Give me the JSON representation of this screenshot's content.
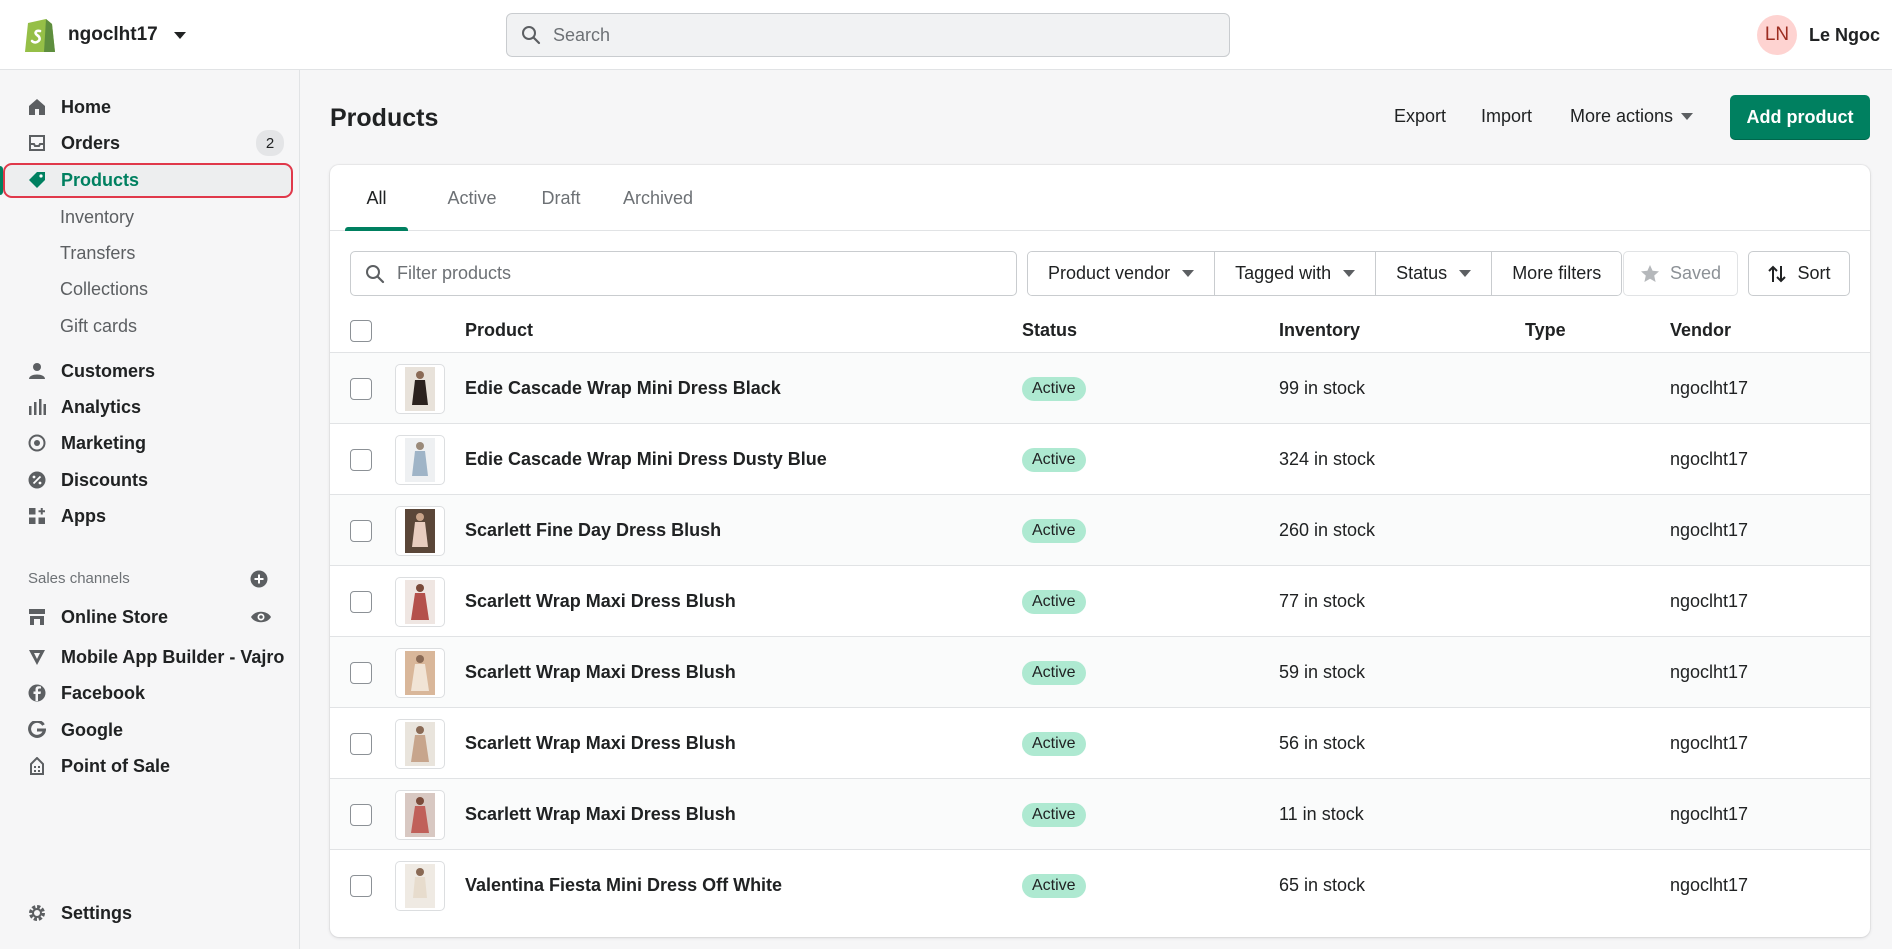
{
  "topbar": {
    "store_name": "ngoclht17",
    "search_placeholder": "Search",
    "user_initials": "LN",
    "user_name": "Le Ngoc"
  },
  "sidebar": {
    "items": [
      {
        "label": "Home",
        "icon": "home-icon"
      },
      {
        "label": "Orders",
        "icon": "inbox-icon",
        "badge": "2"
      },
      {
        "label": "Products",
        "icon": "tag-icon",
        "active": true
      },
      {
        "label": "Customers",
        "icon": "person-icon"
      },
      {
        "label": "Analytics",
        "icon": "bar-chart-icon"
      },
      {
        "label": "Marketing",
        "icon": "target-icon"
      },
      {
        "label": "Discounts",
        "icon": "discount-icon"
      },
      {
        "label": "Apps",
        "icon": "apps-icon"
      }
    ],
    "sub_items": [
      "Inventory",
      "Transfers",
      "Collections",
      "Gift cards"
    ],
    "sales_channels_label": "Sales channels",
    "channels": [
      {
        "label": "Online Store",
        "icon": "store-icon"
      },
      {
        "label": "Mobile App Builder - Vajro",
        "icon": "vajro-icon"
      },
      {
        "label": "Facebook",
        "icon": "facebook-icon"
      },
      {
        "label": "Google",
        "icon": "google-icon"
      },
      {
        "label": "Point of Sale",
        "icon": "pos-icon"
      }
    ],
    "settings_label": "Settings"
  },
  "page": {
    "title": "Products",
    "export_label": "Export",
    "import_label": "Import",
    "more_actions_label": "More actions",
    "add_product_label": "Add product"
  },
  "tabs": [
    "All",
    "Active",
    "Draft",
    "Archived"
  ],
  "filters": {
    "placeholder": "Filter products",
    "product_vendor": "Product vendor",
    "tagged_with": "Tagged with",
    "status": "Status",
    "more_filters": "More filters",
    "saved": "Saved",
    "sort": "Sort"
  },
  "table": {
    "headers": {
      "product": "Product",
      "status": "Status",
      "inventory": "Inventory",
      "type": "Type",
      "vendor": "Vendor"
    },
    "rows": [
      {
        "product": "Edie Cascade Wrap Mini Dress Black",
        "status": "Active",
        "inventory": "99 in stock",
        "type": "",
        "vendor": "ngoclht17"
      },
      {
        "product": "Edie Cascade Wrap Mini Dress Dusty Blue",
        "status": "Active",
        "inventory": "324 in stock",
        "type": "",
        "vendor": "ngoclht17"
      },
      {
        "product": "Scarlett Fine Day Dress Blush",
        "status": "Active",
        "inventory": "260 in stock",
        "type": "",
        "vendor": "ngoclht17"
      },
      {
        "product": "Scarlett Wrap Maxi Dress Blush",
        "status": "Active",
        "inventory": "77 in stock",
        "type": "",
        "vendor": "ngoclht17"
      },
      {
        "product": "Scarlett Wrap Maxi Dress Blush",
        "status": "Active",
        "inventory": "59 in stock",
        "type": "",
        "vendor": "ngoclht17"
      },
      {
        "product": "Scarlett Wrap Maxi Dress Blush",
        "status": "Active",
        "inventory": "56 in stock",
        "type": "",
        "vendor": "ngoclht17"
      },
      {
        "product": "Scarlett Wrap Maxi Dress Blush",
        "status": "Active",
        "inventory": "11 in stock",
        "type": "",
        "vendor": "ngoclht17"
      },
      {
        "product": "Valentina Fiesta Mini Dress Off White",
        "status": "Active",
        "inventory": "65 in stock",
        "type": "",
        "vendor": "ngoclht17"
      }
    ]
  },
  "colors": {
    "accent": "#008060",
    "status_active_bg": "#aee9d1",
    "highlight_ring": "#e0384a"
  }
}
